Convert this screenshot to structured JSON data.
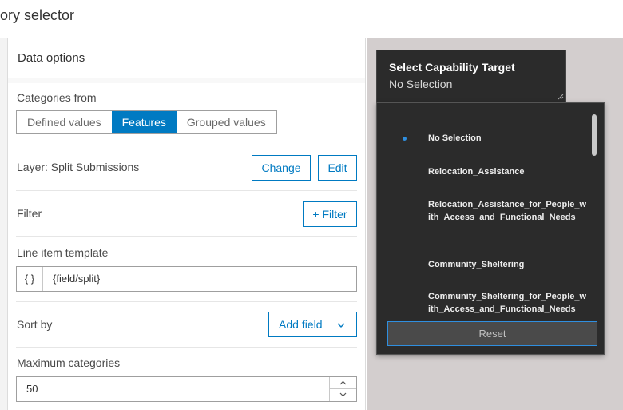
{
  "topbar": {
    "title": "ory selector"
  },
  "panel": {
    "title": "Data options",
    "categories_from": {
      "label": "Categories from",
      "options": [
        "Defined values",
        "Features",
        "Grouped values"
      ],
      "selected": "Features"
    },
    "layer": {
      "label": "Layer: Split Submissions",
      "change_label": "Change",
      "edit_label": "Edit"
    },
    "filter": {
      "label": "Filter",
      "button_label": "+ Filter"
    },
    "line_item": {
      "label": "Line item template",
      "prefix": "{ }",
      "value": "{field/split}"
    },
    "sort_by": {
      "label": "Sort by",
      "button_label": "Add field"
    },
    "max_categories": {
      "label": "Maximum categories",
      "value": "50"
    }
  },
  "capability": {
    "title": "Select Capability Target",
    "value": "No Selection",
    "options": [
      "No Selection",
      "Relocation_Assistance",
      "Relocation_Assistance_for_People_with_Access_and_Functional_Needs",
      "Community_Sheltering",
      "Community_Sheltering_for_People_with_Access_and_Functional_Needs"
    ],
    "selected_index": 0,
    "reset_label": "Reset"
  },
  "colors": {
    "accent": "#007ac2",
    "dark_panel": "#2b2b2b",
    "backdrop": "#d3cece"
  },
  "icons": {
    "dropdown_chevron": "chevron-down-icon",
    "stepper_up": "chevron-up-icon",
    "stepper_down": "chevron-down-icon",
    "bullet": "bullet-icon",
    "grip": "resize-grip-icon"
  }
}
